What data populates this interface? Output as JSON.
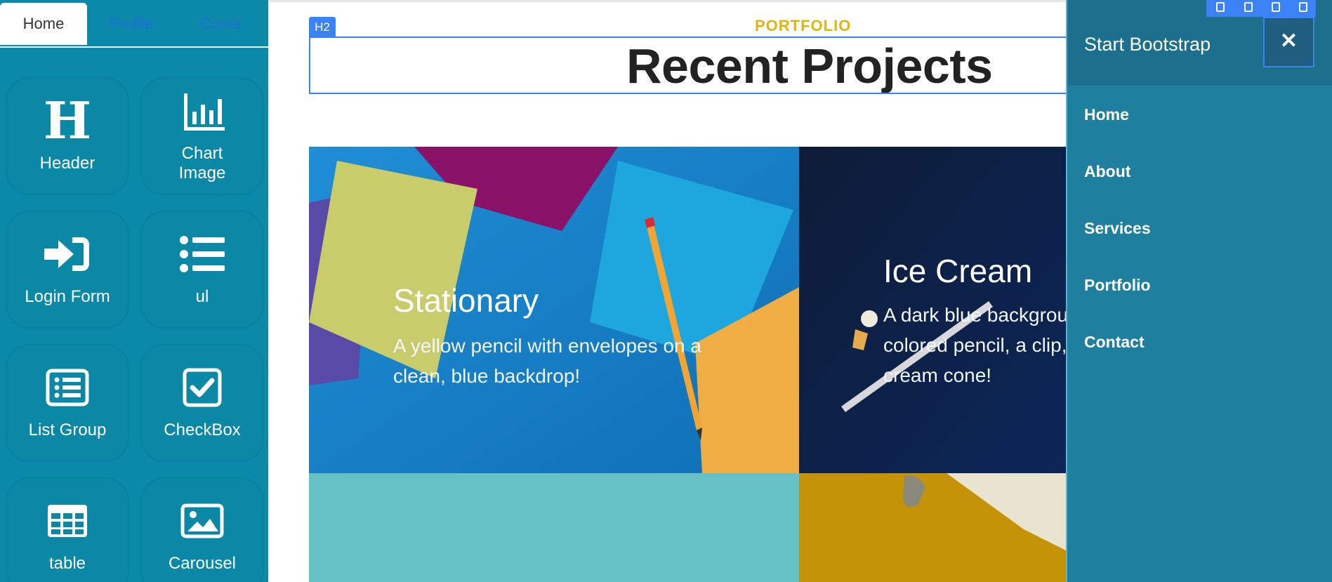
{
  "left_panel": {
    "tabs": [
      "Home",
      "Profile",
      "Conta"
    ],
    "tiles": [
      {
        "label": "Header",
        "icon": "header-icon"
      },
      {
        "label": "Chart\nImage",
        "icon": "chart-icon"
      },
      {
        "label": "Login Form",
        "icon": "login-icon"
      },
      {
        "label": "ul",
        "icon": "list-icon"
      },
      {
        "label": "List Group",
        "icon": "list-group-icon"
      },
      {
        "label": "CheckBox",
        "icon": "checkbox-icon"
      },
      {
        "label": "table",
        "icon": "table-icon"
      },
      {
        "label": "Carousel",
        "icon": "image-icon"
      }
    ]
  },
  "canvas": {
    "kicker": "PORTFOLIO",
    "h2_tag": "H2",
    "title": "Recent Projects",
    "cards": [
      {
        "title": "Stationary",
        "text": "A yellow pencil with envelopes on a clean, blue backdrop!"
      },
      {
        "title": "Ice Cream",
        "text": "A dark blue background with a colored pencil, a clip, and a tiny ice cream cone!"
      }
    ]
  },
  "drawer": {
    "brand": "Start Bootstrap",
    "close": "✕",
    "nav": [
      "Home",
      "About",
      "Services",
      "Portfolio",
      "Contact"
    ]
  },
  "colors": {
    "panel": "#0a8aa8",
    "accent": "#e5b30d",
    "selection": "#3b82f6",
    "drawer": "#1f7f9f"
  }
}
